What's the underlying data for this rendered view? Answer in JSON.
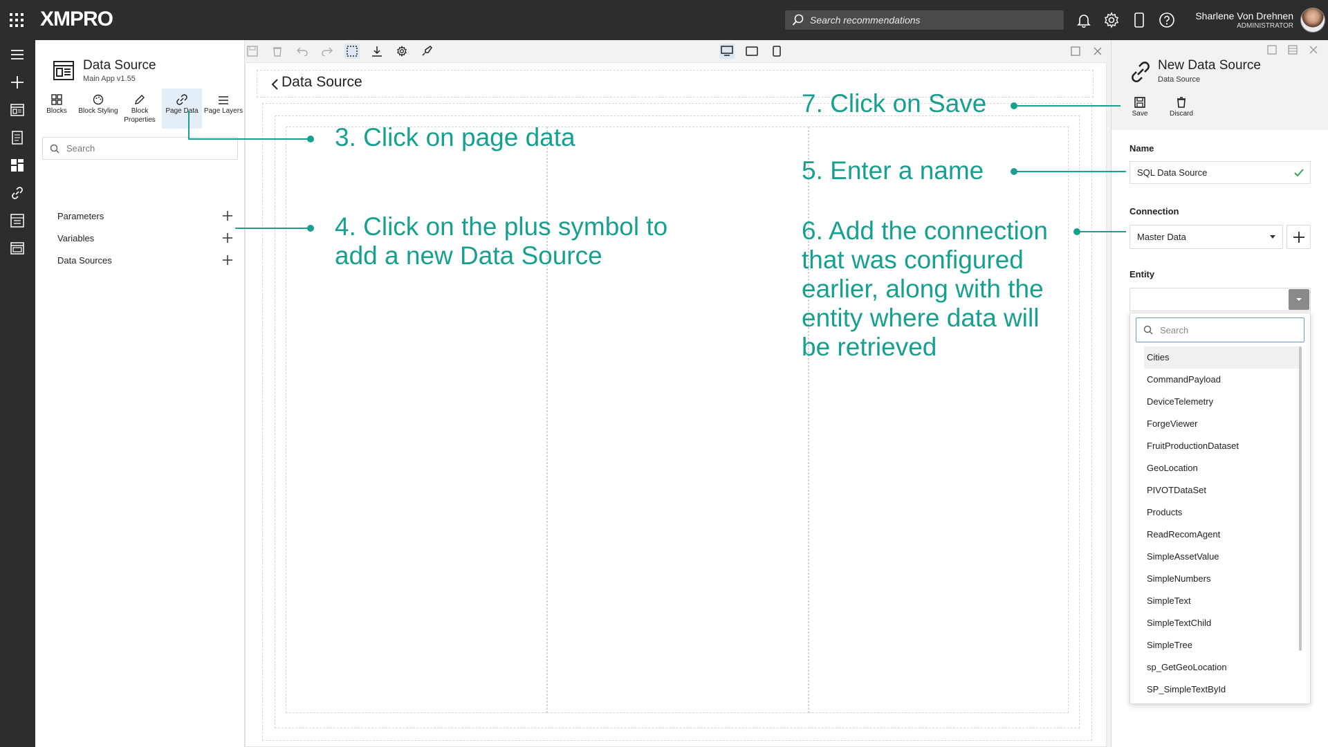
{
  "topbar": {
    "brand": "XMPRO",
    "search_placeholder": "Search recommendations",
    "user_name": "Sharlene Von Drehnen",
    "user_role": "ADMINISTRATOR",
    "icons": [
      "apps-grid-icon",
      "bell-icon",
      "gear-icon",
      "mobile-icon",
      "help-icon"
    ]
  },
  "rail": {
    "icons": [
      "menu-icon",
      "plus-icon",
      "apps-icon",
      "recommendations-icon",
      "dashboard-icon",
      "link-icon",
      "datastreams-icon",
      "calendar-icon",
      "xmpro-logo-icon"
    ]
  },
  "left_panel": {
    "title": "Data Source",
    "subtitle": "Main App v1.55",
    "tabs": [
      {
        "label": "Blocks"
      },
      {
        "label": "Block Styling"
      },
      {
        "label": "Block Properties"
      },
      {
        "label": "Page Data"
      },
      {
        "label": "Page Layers"
      }
    ],
    "search_placeholder": "Search",
    "rows": [
      {
        "label": "Parameters"
      },
      {
        "label": "Variables"
      },
      {
        "label": "Data Sources"
      }
    ]
  },
  "canvas": {
    "page_title": "Data Source",
    "toolbar_icons": [
      "save-icon",
      "delete-icon",
      "undo-icon",
      "redo-icon",
      "select-icon",
      "download-icon",
      "settings-icon",
      "publish-icon",
      "desktop-icon",
      "tablet-icon",
      "mobile-icon",
      "maximize-icon",
      "close-icon"
    ]
  },
  "right_panel": {
    "title": "New Data Source",
    "subtitle": "Data Source",
    "save_label": "Save",
    "discard_label": "Discard",
    "name_label": "Name",
    "name_value": "SQL Data Source",
    "connection_label": "Connection",
    "connection_value": "Master Data",
    "entity_label": "Entity",
    "entity_search_placeholder": "Search",
    "entities": [
      "Cities",
      "CommandPayload",
      "DeviceTelemetry",
      "ForgeViewer",
      "FruitProductionDataset",
      "GeoLocation",
      "PIVOTDataSet",
      "Products",
      "ReadRecomAgent",
      "SimpleAssetValue",
      "SimpleNumbers",
      "SimpleText",
      "SimpleTextChild",
      "SimpleTree",
      "sp_GetGeoLocation",
      "SP_SimpleTextById"
    ]
  },
  "annotations": {
    "step3": "3. Click on page data",
    "step4": "4. Click on the plus symbol to\nadd a new Data Source",
    "step5": "5. Enter a name",
    "step6": "6. Add the connection\nthat was configured\nearlier, along with the\nentity where data will\nbe retrieved",
    "step7": "7. Click on Save"
  },
  "colors": {
    "annotation": "#18a08f",
    "topbar": "#2d2d2d",
    "active_tab": "#e4eef7"
  }
}
